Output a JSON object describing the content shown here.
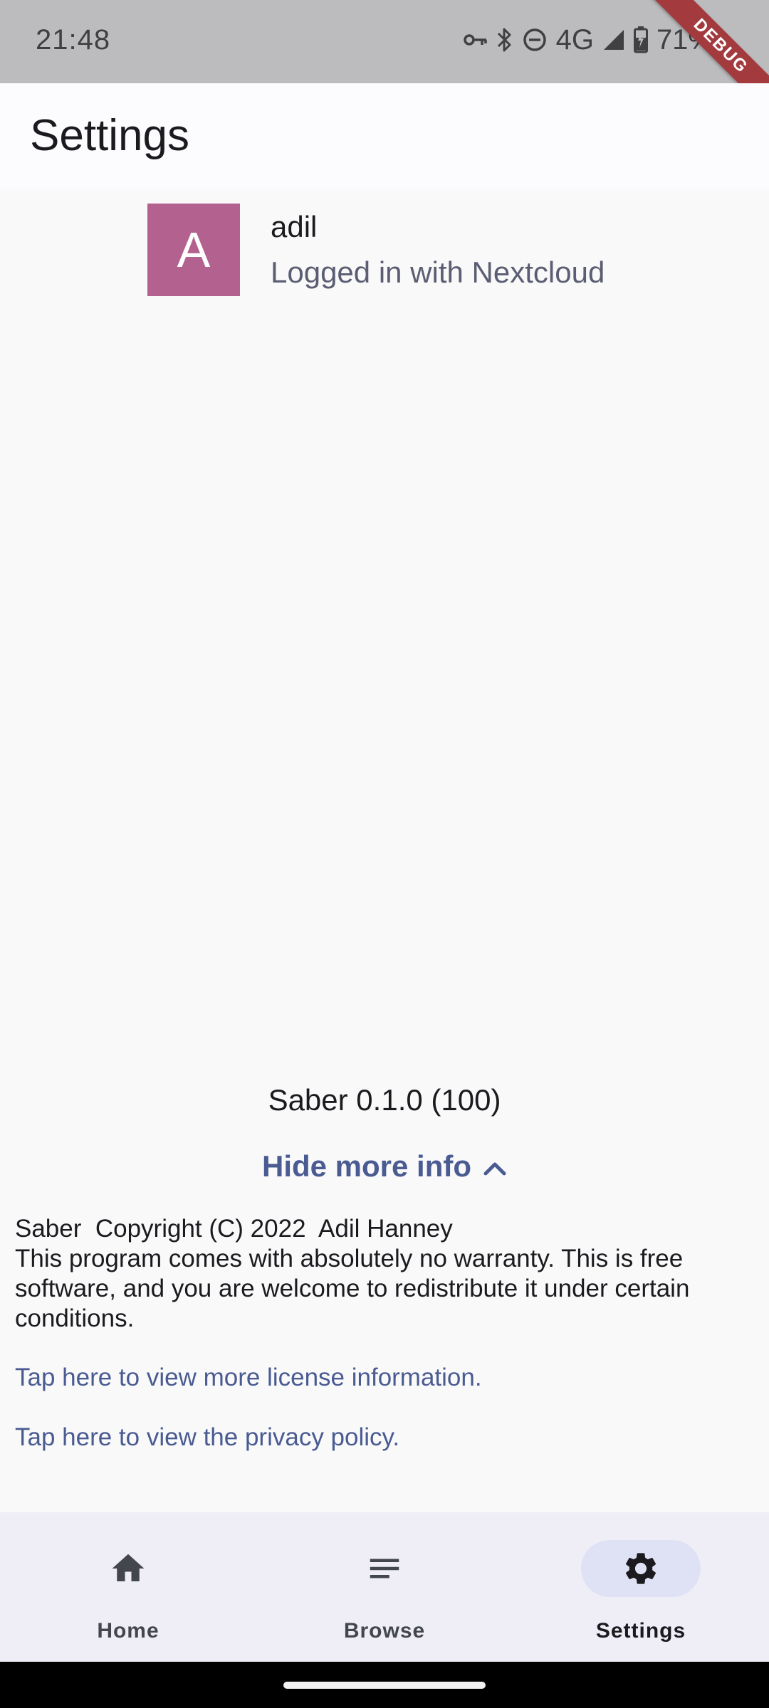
{
  "status_bar": {
    "time": "21:48",
    "network": "4G",
    "battery": "71%",
    "icons": [
      "vpn-key-icon",
      "bluetooth-icon",
      "do-not-disturb-icon",
      "signal-icon",
      "battery-charging-icon"
    ]
  },
  "debug_banner": "DEBUG",
  "app_bar": {
    "title": "Settings"
  },
  "account": {
    "avatar_letter": "A",
    "avatar_color": "#b3628f",
    "username": "adil",
    "subtitle": "Logged in with Nextcloud"
  },
  "about": {
    "version": "Saber 0.1.0 (100)",
    "toggle_label": "Hide more info",
    "copyright": "Saber  Copyright (C) 2022  Adil Hanney",
    "warranty": "This program comes with absolutely no warranty. This is free software, and you are welcome to redistribute it under certain conditions.",
    "license_link": "Tap here to view more license information.",
    "privacy_link": "Tap here to view the privacy policy."
  },
  "bottom_nav": {
    "items": [
      {
        "label": "Home",
        "icon": "home-icon",
        "active": false
      },
      {
        "label": "Browse",
        "icon": "browse-icon",
        "active": false
      },
      {
        "label": "Settings",
        "icon": "gear-icon",
        "active": true
      }
    ]
  },
  "colors": {
    "accent": "#4a5b92",
    "active_pill": "#dfe2f4",
    "nav_background": "#efeef6"
  }
}
